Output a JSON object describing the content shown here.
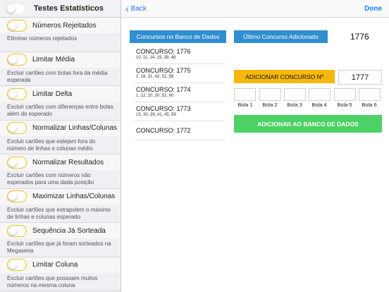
{
  "sidebar": {
    "title": "Testes Estatísticos",
    "items": [
      {
        "label": "Números Rejeitados",
        "desc": "Eliminar números rejeitados"
      },
      {
        "label": "Limitar Média",
        "desc": "Excluir cartões com bolas fora da média esperada"
      },
      {
        "label": "Limitar Delta",
        "desc": "Excluir cartões com diferenças entre bolas além do esperado"
      },
      {
        "label": "Normalizar Linhas/Colunas",
        "desc": "Excluir cartões que estejam fora do número de linhas e colunas médio"
      },
      {
        "label": "Normalizar Resultados",
        "desc": "Excluir cartões com números não esperados para uma dada posição"
      },
      {
        "label": "Maximizar Linhas/Colunas",
        "desc": "Excluir cartões que extrapolem o máximo de linhas e colunas esperado"
      },
      {
        "label": "Sequência Já Sorteada",
        "desc": "Excluir cartões que já foram sorteados na Megasena"
      },
      {
        "label": "Limitar Coluna",
        "desc": "Excluir cartões que possuam muitos números na mesma coluna"
      }
    ]
  },
  "nav": {
    "back_label": "Back",
    "done_label": "Done"
  },
  "main": {
    "db_button": "Concursos no Banco de Dados",
    "last_button": "Último Concurso Adicionado",
    "last_value": "1776",
    "contests": [
      {
        "title": "CONCURSO: 1776",
        "numbers": "10, 11, 14, 19, 39, 48"
      },
      {
        "title": "CONCURSO: 1775",
        "numbers": "2, 18, 31, 42, 51, 56"
      },
      {
        "title": "CONCURSO: 1774",
        "numbers": "1, 12, 20, 30, 52, 60"
      },
      {
        "title": "CONCURSO: 1773",
        "numbers": "15, 30, 39, 41, 45, 59"
      },
      {
        "title": "CONCURSO: 1772",
        "numbers": ""
      }
    ],
    "add_contest_button": "ADICIONAR CONCURSO Nº",
    "add_contest_value": "1777",
    "balls": [
      "Bola 1",
      "Bola 2",
      "Bola 3",
      "Bola 4",
      "Bola 5",
      "Bola 6"
    ],
    "add_db_button": "ADICIONAR AO BANCO DE DADOS"
  },
  "colors": {
    "accent_blue": "#2f8fd1",
    "accent_orange": "#f6b70c",
    "accent_green": "#4cd164",
    "link_blue": "#1a7cf5"
  }
}
